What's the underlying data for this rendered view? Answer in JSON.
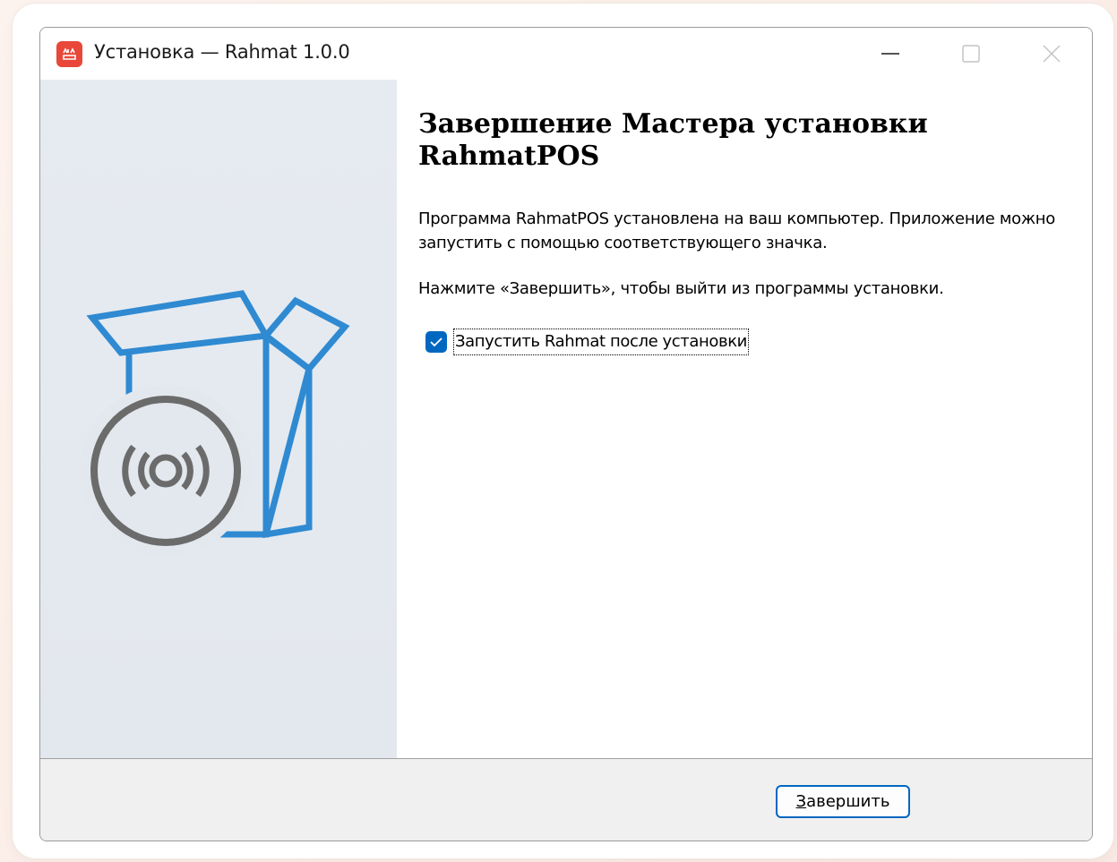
{
  "window": {
    "title": "Установка — Rahmat 1.0.0",
    "icon": "rahmat-app-icon",
    "controls": {
      "minimize": "minimize-icon",
      "maximize": "maximize-icon",
      "close": "close-icon"
    }
  },
  "wizard": {
    "heading": "Завершение Мастера установки RahmatPOS",
    "description": "Программа RahmatPOS установлена на ваш компьютер. Приложение можно запустить с помощью соответствующего значка.",
    "hint": "Нажмите «Завершить», чтобы выйти из программы установки.",
    "launch_checkbox": {
      "label": "Запустить Rahmat после установки",
      "checked": true
    },
    "illustration": "box-with-disc-icon"
  },
  "footer": {
    "finish_button": {
      "accel": "З",
      "rest": "авершить"
    }
  },
  "colors": {
    "accent": "#0067c0",
    "app_icon": "#e8473a",
    "illustration_box": "#2f8ad2",
    "illustration_disc": "#6b6b6b",
    "sidebar_bg": "#e6ebf1"
  }
}
